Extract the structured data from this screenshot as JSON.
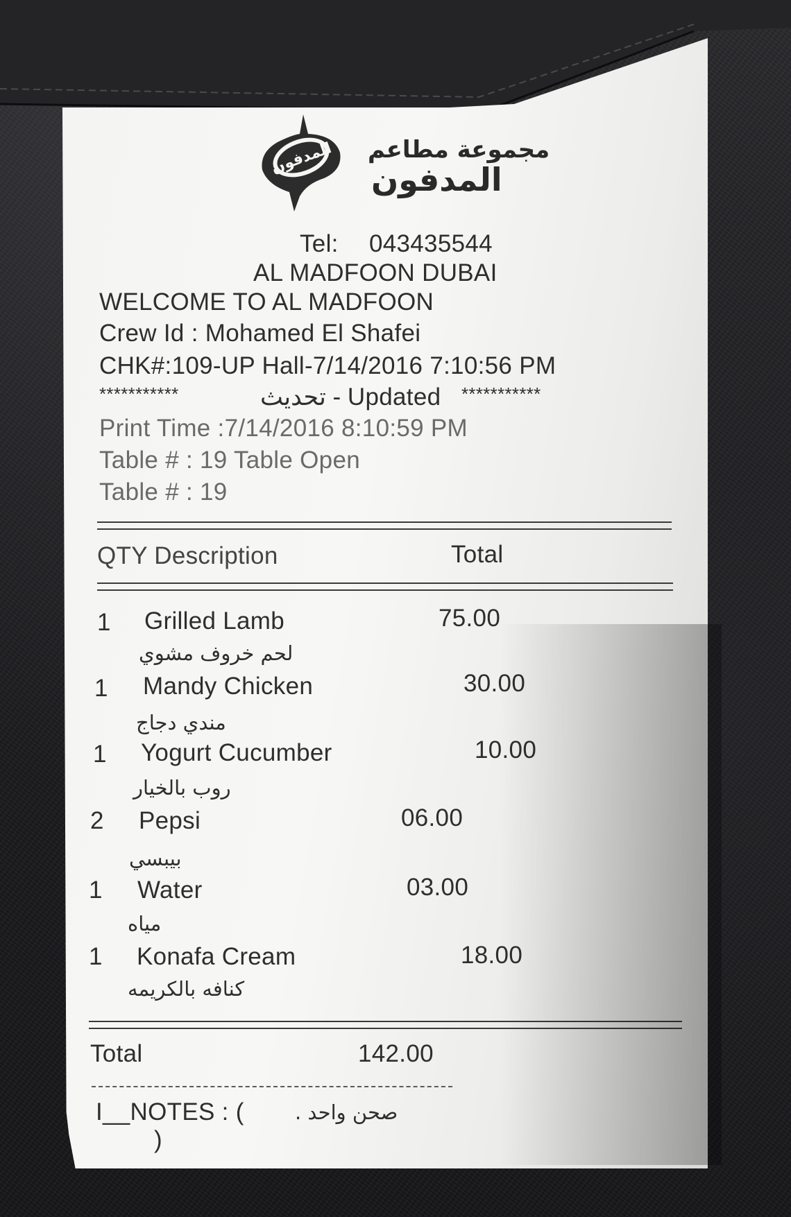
{
  "header": {
    "brand_arabic_line1": "مجموعة مطاعم",
    "brand_arabic_line2": "المدفون",
    "logo_text": "المدفون",
    "tel_label": "Tel:",
    "tel_value": "043435544",
    "location": "AL MADFOON DUBAI",
    "welcome": "WELCOME TO AL MADFOON",
    "crew": "Crew Id : Mohamed El Shafei",
    "check": "CHK#:109-UP Hall-7/14/2016 7:10:56 PM",
    "updated_stars_left": "***********",
    "updated_text": "تحديث - Updated",
    "updated_stars_right": "***********",
    "print_time": "Print Time :7/14/2016 8:10:59 PM",
    "table_open": "Table # : 19  Table Open",
    "table": "Table # : 19"
  },
  "columns": {
    "qty_desc": "QTY  Description",
    "total": "Total"
  },
  "items": [
    {
      "qty": "1",
      "name": "Grilled Lamb",
      "total": "75.00",
      "arabic": "لحم خروف مشوي"
    },
    {
      "qty": "1",
      "name": "Mandy Chicken",
      "total": "30.00",
      "arabic": "مندي دجاج"
    },
    {
      "qty": "1",
      "name": "Yogurt Cucumber",
      "total": "10.00",
      "arabic": "روب بالخيار"
    },
    {
      "qty": "2",
      "name": "Pepsi",
      "total": "06.00",
      "arabic": "بيبسي"
    },
    {
      "qty": "1",
      "name": "Water",
      "total": "03.00",
      "arabic": "مياه"
    },
    {
      "qty": "1",
      "name": "Konafa Cream",
      "total": "18.00",
      "arabic": "كنافه بالكريمه"
    }
  ],
  "summary": {
    "total_label": "Total",
    "total_value": "142.00"
  },
  "notes": {
    "prefix": "I__NOTES : (",
    "arabic": "صحن واحد .",
    "close": ")"
  },
  "colors": {
    "paper": "#f5f5f3",
    "ink": "#2e2e2e",
    "leather": "#1e1e21"
  }
}
